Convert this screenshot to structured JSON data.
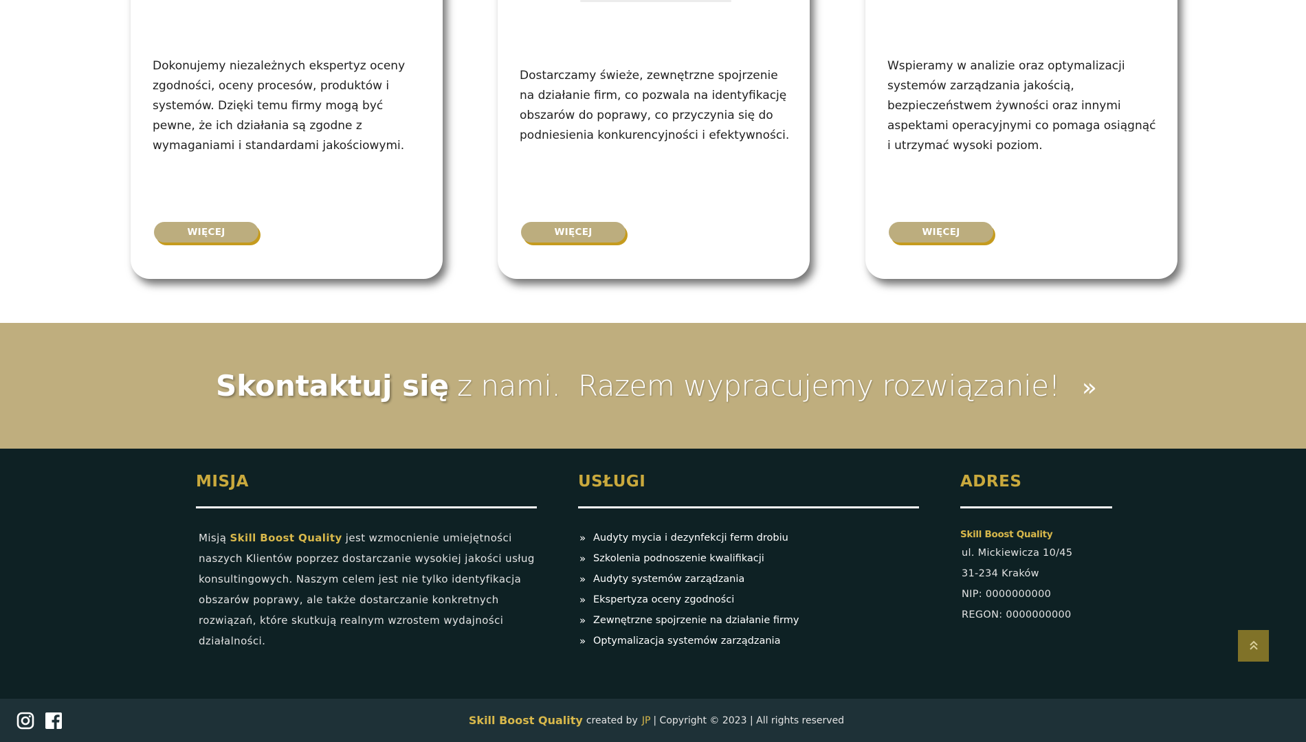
{
  "cards": [
    {
      "text": "Dokonujemy niezależnych ekspertyz oceny zgodności, oceny procesów, produktów i systemów. Dzięki temu firmy mogą być pewne, że ich działania są zgodne z wymaganiami i standardami jakościowymi.",
      "button": "WIĘCEJ"
    },
    {
      "text": "Dostarczamy świeże, zewnętrzne spojrzenie na działanie firm, co pozwala na identyfikację obszarów do poprawy, co przyczynia się do podniesienia konkurencyjności i efektywności.",
      "button": "WIĘCEJ"
    },
    {
      "text": "Wspieramy w analizie oraz optymalizacji systemów zarządzania jakością, bezpieczeństwem żywności oraz innymi aspektami operacyjnymi co pomaga osiągnąć i utrzymać wysoki poziom.",
      "button": "WIĘCEJ"
    }
  ],
  "cta": {
    "bold": "Skontaktuj się",
    "light": "z nami.  Razem wypracujemy rozwiązanie!",
    "arrow": "»"
  },
  "footer": {
    "misja": {
      "title": "MISJA",
      "prefix": "Misją ",
      "brand": "Skill Boost Quality",
      "text": " jest wzmocnienie umiejętności naszych Klientów poprzez dostarczanie wysokiej jakości usług konsultingowych. Naszym celem jest nie tylko identyfikacja obszarów poprawy, ale także dostarczanie konkretnych rozwiązań, które skutkują realnym wzrostem wydajności działalności."
    },
    "uslugi": {
      "title": "USŁUGI",
      "items": [
        "Audyty mycia i dezynfekcji ferm drobiu",
        "Szkolenia podnoszenie kwalifikacji",
        "Audyty systemów zarządzania",
        "Ekspertyza oceny zgodności",
        "Zewnętrzne spojrzenie na działanie firmy",
        "Optymalizacja systemów zarządzania"
      ]
    },
    "adres": {
      "title": "ADRES",
      "brand": "Skill Boost Quality",
      "street": "ul. Mickiewicza 10/45",
      "city": "31-234 Kraków",
      "nip": "NIP: 0000000000",
      "regon": "REGON: 0000000000"
    }
  },
  "bottom": {
    "brand": "Skill Boost Quality",
    "created_by": "created by",
    "author": "JP",
    "copyright": "| Copyright © 2023 | All rights reserved"
  },
  "icons": {
    "instagram": "instagram-icon",
    "facebook": "facebook-icon",
    "scroll_top": "double-chevron-up-icon"
  },
  "colors": {
    "gold": "#bfae7e",
    "accent": "#d8b84b",
    "footer_bg": "#0e2124",
    "bottom_bg": "#1e3137"
  }
}
